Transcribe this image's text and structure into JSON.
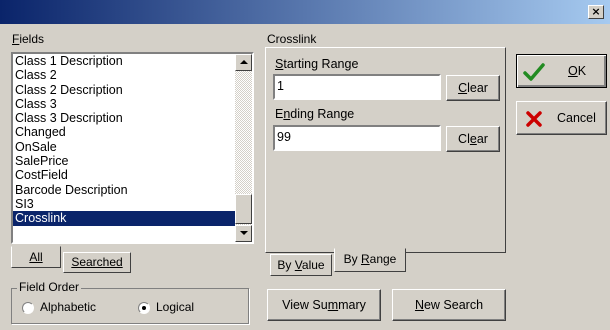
{
  "window": {
    "close_glyph": "×"
  },
  "fields": {
    "label": "Fields",
    "items": [
      "Class 1 Description",
      "Class 2",
      "Class 2 Description",
      "Class 3",
      "Class 3 Description",
      "Changed",
      "OnSale",
      "SalePrice",
      "CostField",
      "Barcode Description",
      "SI3",
      "Crosslink"
    ],
    "selected": "Crosslink",
    "tabs": {
      "all": "All",
      "searched": "Searched"
    }
  },
  "crosslink": {
    "label": "Crosslink",
    "starting_label": "Starting Range",
    "starting_value": "1",
    "ending_label": "Ending Range",
    "ending_value": "99",
    "clear_label": "Clear",
    "tabs": {
      "by_value": "By Value",
      "by_range": "By Range"
    }
  },
  "field_order": {
    "label": "Field Order",
    "alphabetic": "Alphabetic",
    "logical": "Logical",
    "selected": "Logical"
  },
  "buttons": {
    "ok": "OK",
    "cancel": "Cancel",
    "view_summary": "View Summary",
    "new_search": "New Search"
  },
  "colors": {
    "ok_icon": "#228b22",
    "cancel_icon": "#cc0000",
    "selection": "#0a246a"
  }
}
